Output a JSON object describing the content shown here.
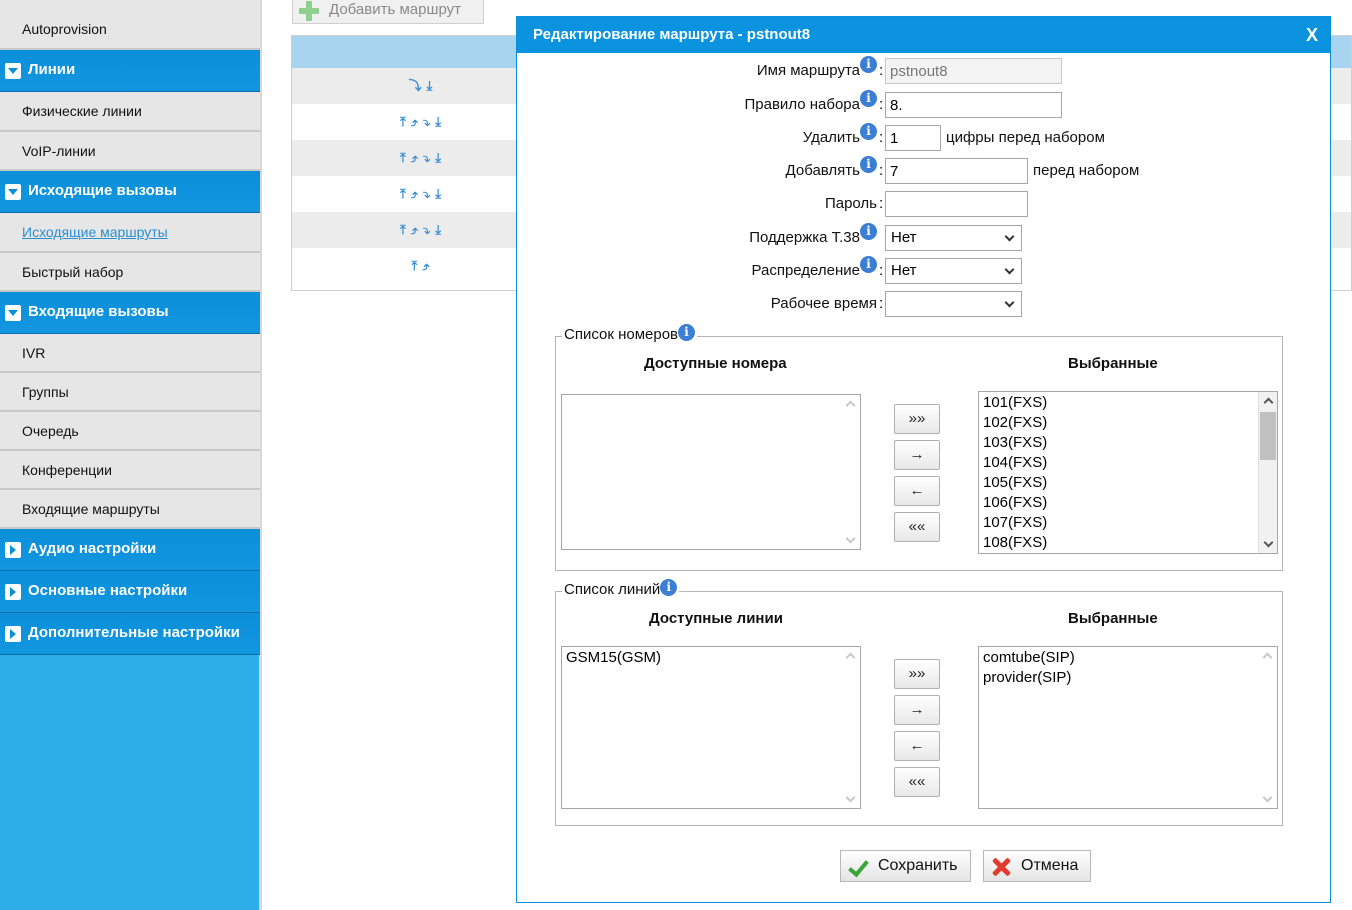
{
  "sidebar": {
    "items": {
      "autoprovision": "Autoprovision",
      "lines_head": "Линии",
      "physical_lines": "Физические линии",
      "voip_lines": "VoIP-линии",
      "outgoing_head": "Исходящие вызовы",
      "outgoing_routes": "Исходящие маршруты",
      "speed_dial": "Быстрый набор",
      "incoming_head": "Входящие вызовы",
      "ivr": "IVR",
      "groups": "Группы",
      "queue": "Очередь",
      "conferences": "Конференции",
      "incoming_routes": "Входящие маршруты",
      "audio_head": "Аудио настройки",
      "basic_head": "Основные настройки",
      "advanced_head": "Дополнительные настройки"
    }
  },
  "background": {
    "add_route_label": "Добавить маршрут",
    "row_icons": [
      "⤵⤓",
      "⤒⤴⤵⤓",
      "⤒⤴⤵⤓",
      "⤒⤴⤵⤓",
      "⤒⤴⤵⤓",
      "⤒⤴"
    ]
  },
  "dialog": {
    "title": "Редактирование маршрута - pstnout8",
    "close_label": "X",
    "fields": {
      "route_name": {
        "label": "Имя маршрута",
        "value": "pstnout8"
      },
      "dial_rule": {
        "label": "Правило набора",
        "value": "8."
      },
      "strip": {
        "label": "Удалить",
        "value": "1",
        "suffix": "цифры перед набором"
      },
      "prepend": {
        "label": "Добавлять",
        "value": "7",
        "suffix": "перед набором"
      },
      "password": {
        "label": "Пароль",
        "value": ""
      },
      "t38": {
        "label": "Поддержка T.38",
        "value": "Нет"
      },
      "distribution": {
        "label": "Распределение",
        "value": "Нет"
      },
      "work_time": {
        "label": "Рабочее время",
        "value": ""
      }
    },
    "numbers": {
      "legend": "Список номеров",
      "available_title": "Доступные номера",
      "selected_title": "Выбранные",
      "available": [],
      "selected": [
        "101(FXS)",
        "102(FXS)",
        "103(FXS)",
        "104(FXS)",
        "105(FXS)",
        "106(FXS)",
        "107(FXS)",
        "108(FXS)"
      ]
    },
    "lines": {
      "legend": "Список линий",
      "available_title": "Доступные линии",
      "selected_title": "Выбранные",
      "available": [
        "GSM15(GSM)"
      ],
      "selected": [
        "comtube(SIP)",
        "provider(SIP)"
      ]
    },
    "move_buttons": {
      "add_all": "»»",
      "add": "→",
      "remove": "←",
      "remove_all": "««"
    },
    "save_label": "Сохранить",
    "cancel_label": "Отмена"
  },
  "colors": {
    "sidebar_bg": "#2eaee8",
    "header_blue": "#0b93e0",
    "info_icon": "#3b7fd4"
  }
}
